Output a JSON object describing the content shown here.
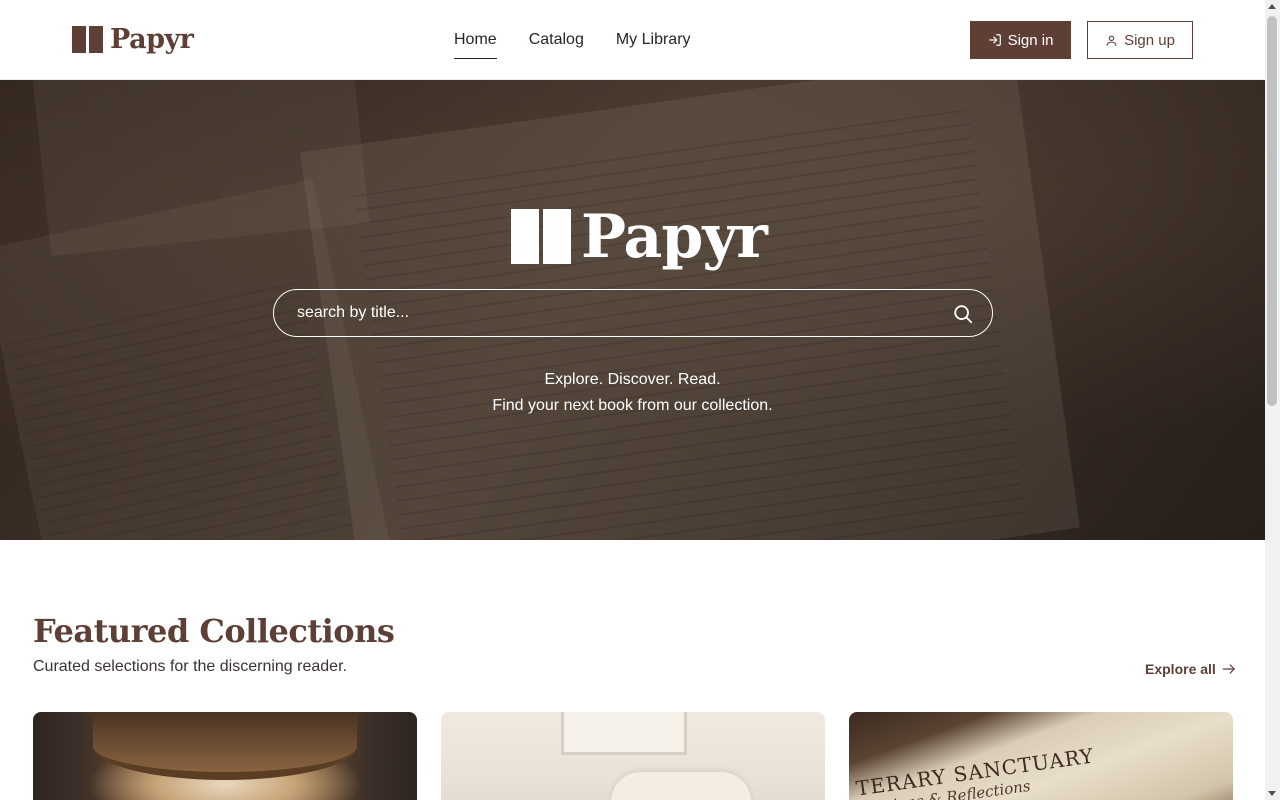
{
  "header": {
    "brand": "Papyr",
    "nav": [
      {
        "label": "Home",
        "active": true
      },
      {
        "label": "Catalog",
        "active": false
      },
      {
        "label": "My Library",
        "active": false
      }
    ],
    "signin_label": "Sign in",
    "signup_label": "Sign up"
  },
  "hero": {
    "brand": "Papyr",
    "search_placeholder": "search by title...",
    "tagline_line1": "Explore. Discover. Read.",
    "tagline_line2": "Find your next book from our collection."
  },
  "featured": {
    "title": "Featured Collections",
    "subtitle": "Curated selections for the discerning reader.",
    "explore_label": "Explore all",
    "cards": [
      {
        "image": "grand-library-hall"
      },
      {
        "image": "cozy-reading-chair"
      },
      {
        "image": "literary-sanctuary-book",
        "cover_title": "TERARY SANCTUARY",
        "cover_subtitle": "ections & Reflections"
      }
    ]
  },
  "colors": {
    "brand": "#5e3f36",
    "text": "#2b2522",
    "white": "#ffffff"
  },
  "icons": {
    "signin": "sign-in-icon",
    "signup": "user-icon",
    "search": "search-icon",
    "explore": "arrow-right-icon"
  }
}
